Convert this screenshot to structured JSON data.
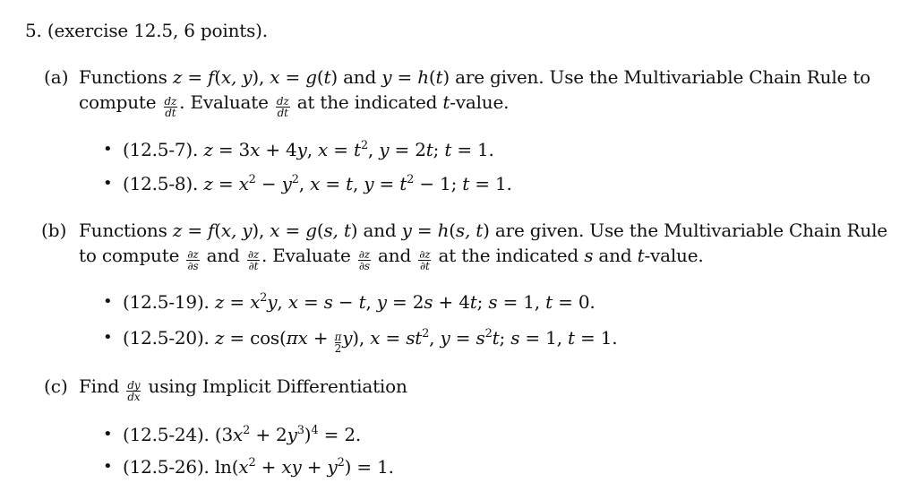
{
  "header": {
    "title": "5. (exercise 12.5, 6 points)."
  },
  "parts": [
    {
      "label": "(a)",
      "lines": [
        [
          {
            "t": "Functions "
          },
          {
            "m": "z"
          },
          {
            "t": " = "
          },
          {
            "m": "f"
          },
          {
            "t": "("
          },
          {
            "m": "x, y"
          },
          {
            "t": "), "
          },
          {
            "m": "x"
          },
          {
            "t": " = "
          },
          {
            "m": "g"
          },
          {
            "t": "("
          },
          {
            "m": "t"
          },
          {
            "t": ") and "
          },
          {
            "m": "y"
          },
          {
            "t": " = "
          },
          {
            "m": "h"
          },
          {
            "t": "("
          },
          {
            "m": "t"
          },
          {
            "t": ") are given. Use the Multivariable Chain Rule to"
          }
        ],
        [
          {
            "t": "compute "
          },
          {
            "f": [
              "dz",
              "dt"
            ]
          },
          {
            "t": ". Evaluate "
          },
          {
            "f": [
              "dz",
              "dt"
            ]
          },
          {
            "t": " at the indicated "
          },
          {
            "m": "t"
          },
          {
            "t": "-value."
          }
        ]
      ],
      "items": [
        [
          {
            "t": "(12.5-7).  "
          },
          {
            "m": "z"
          },
          {
            "t": " = 3"
          },
          {
            "m": "x"
          },
          {
            "t": " + 4"
          },
          {
            "m": "y"
          },
          {
            "t": ", "
          },
          {
            "m": "x"
          },
          {
            "t": " = "
          },
          {
            "m": "t"
          },
          {
            "s": "2"
          },
          {
            "t": ", "
          },
          {
            "m": "y"
          },
          {
            "t": " = 2"
          },
          {
            "m": "t"
          },
          {
            "t": "; "
          },
          {
            "m": "t"
          },
          {
            "t": " = 1."
          }
        ],
        [
          {
            "t": "(12.5-8).  "
          },
          {
            "m": "z"
          },
          {
            "t": " = "
          },
          {
            "m": "x"
          },
          {
            "s": "2"
          },
          {
            "t": " − "
          },
          {
            "m": "y"
          },
          {
            "s": "2"
          },
          {
            "t": ", "
          },
          {
            "m": "x"
          },
          {
            "t": " = "
          },
          {
            "m": "t"
          },
          {
            "t": ", "
          },
          {
            "m": "y"
          },
          {
            "t": " = "
          },
          {
            "m": "t"
          },
          {
            "s": "2"
          },
          {
            "t": " − 1; "
          },
          {
            "m": "t"
          },
          {
            "t": " = 1."
          }
        ]
      ]
    },
    {
      "label": "(b)",
      "lines": [
        [
          {
            "t": "Functions "
          },
          {
            "m": "z"
          },
          {
            "t": " = "
          },
          {
            "m": "f"
          },
          {
            "t": "("
          },
          {
            "m": "x, y"
          },
          {
            "t": "), "
          },
          {
            "m": "x"
          },
          {
            "t": " = "
          },
          {
            "m": "g"
          },
          {
            "t": "("
          },
          {
            "m": "s, t"
          },
          {
            "t": ") and "
          },
          {
            "m": "y"
          },
          {
            "t": " = "
          },
          {
            "m": "h"
          },
          {
            "t": "("
          },
          {
            "m": "s, t"
          },
          {
            "t": ") are given. Use the Multivariable Chain Rule"
          }
        ],
        [
          {
            "t": "to compute "
          },
          {
            "f": [
              "∂z",
              "∂s"
            ]
          },
          {
            "t": " and "
          },
          {
            "f": [
              "∂z",
              "∂t"
            ]
          },
          {
            "t": ". Evaluate "
          },
          {
            "f": [
              "∂z",
              "∂s"
            ]
          },
          {
            "t": " and "
          },
          {
            "f": [
              "∂z",
              "∂t"
            ]
          },
          {
            "t": " at the indicated "
          },
          {
            "m": "s"
          },
          {
            "t": " and "
          },
          {
            "m": "t"
          },
          {
            "t": "-value."
          }
        ]
      ],
      "items": [
        [
          {
            "t": "(12.5-19).  "
          },
          {
            "m": "z"
          },
          {
            "t": " = "
          },
          {
            "m": "x"
          },
          {
            "s": "2"
          },
          {
            "m": "y"
          },
          {
            "t": ", "
          },
          {
            "m": "x"
          },
          {
            "t": " = "
          },
          {
            "m": "s"
          },
          {
            "t": " − "
          },
          {
            "m": "t"
          },
          {
            "t": ", "
          },
          {
            "m": "y"
          },
          {
            "t": " = 2"
          },
          {
            "m": "s"
          },
          {
            "t": " + 4"
          },
          {
            "m": "t"
          },
          {
            "t": "; "
          },
          {
            "m": "s"
          },
          {
            "t": " = 1, "
          },
          {
            "m": "t"
          },
          {
            "t": " = 0."
          }
        ],
        [
          {
            "t": "(12.5-20).  "
          },
          {
            "m": "z"
          },
          {
            "t": " = cos("
          },
          {
            "m": "πx"
          },
          {
            "t": " + "
          },
          {
            "sf": [
              "π",
              "2"
            ]
          },
          {
            "m": "y"
          },
          {
            "t": "), "
          },
          {
            "m": "x"
          },
          {
            "t": " = "
          },
          {
            "m": "st"
          },
          {
            "s": "2"
          },
          {
            "t": ", "
          },
          {
            "m": "y"
          },
          {
            "t": " = "
          },
          {
            "m": "s"
          },
          {
            "s": "2"
          },
          {
            "m": "t"
          },
          {
            "t": "; "
          },
          {
            "m": "s"
          },
          {
            "t": " = 1, "
          },
          {
            "m": "t"
          },
          {
            "t": " = 1."
          }
        ]
      ]
    },
    {
      "label": "(c)",
      "lines": [
        [
          {
            "t": "Find "
          },
          {
            "f": [
              "dy",
              "dx"
            ]
          },
          {
            "t": " using Implicit Differentiation"
          }
        ]
      ],
      "items": [
        [
          {
            "t": "(12.5-24).  (3"
          },
          {
            "m": "x"
          },
          {
            "s": "2"
          },
          {
            "t": " + 2"
          },
          {
            "m": "y"
          },
          {
            "s": "3"
          },
          {
            "t": ")"
          },
          {
            "s": "4"
          },
          {
            "t": " = 2."
          }
        ],
        [
          {
            "t": "(12.5-26).  ln("
          },
          {
            "m": "x"
          },
          {
            "s": "2"
          },
          {
            "t": " + "
          },
          {
            "m": "xy"
          },
          {
            "t": " + "
          },
          {
            "m": "y"
          },
          {
            "s": "2"
          },
          {
            "t": ") = 1."
          }
        ]
      ]
    }
  ],
  "bullet_glyph": "•"
}
